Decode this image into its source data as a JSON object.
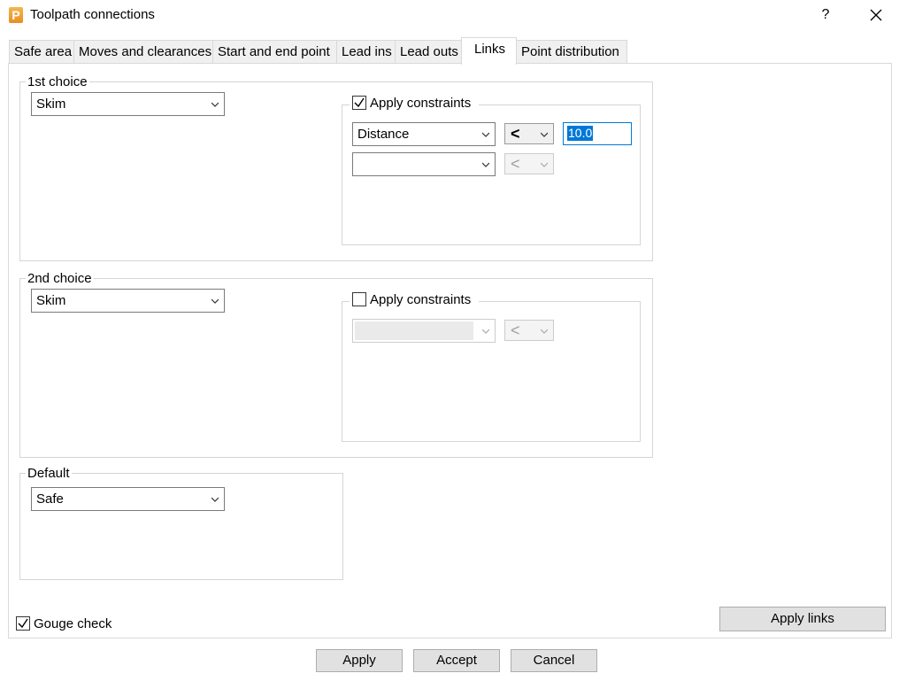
{
  "window": {
    "title": "Toolpath connections",
    "icon_letter": "P",
    "help": "?"
  },
  "tabs": [
    "Safe area",
    "Moves and clearances",
    "Start and end point",
    "Lead ins",
    "Lead outs",
    "Links",
    "Point distribution"
  ],
  "first_choice": {
    "label": "1st choice",
    "value": "Skim",
    "constraints": {
      "label": "Apply constraints",
      "checked": true,
      "row1": {
        "field": "Distance",
        "operator": "<",
        "value": "10.0"
      },
      "row2": {
        "field": "",
        "operator": "<"
      }
    }
  },
  "second_choice": {
    "label": "2nd choice",
    "value": "Skim",
    "constraints": {
      "label": "Apply constraints",
      "checked": false,
      "row1": {
        "field": "",
        "operator": "<"
      }
    }
  },
  "default": {
    "label": "Default",
    "value": "Safe"
  },
  "gouge_check": {
    "label": "Gouge check",
    "checked": true
  },
  "apply_links": "Apply links",
  "buttons": {
    "apply": "Apply",
    "accept": "Accept",
    "cancel": "Cancel"
  }
}
